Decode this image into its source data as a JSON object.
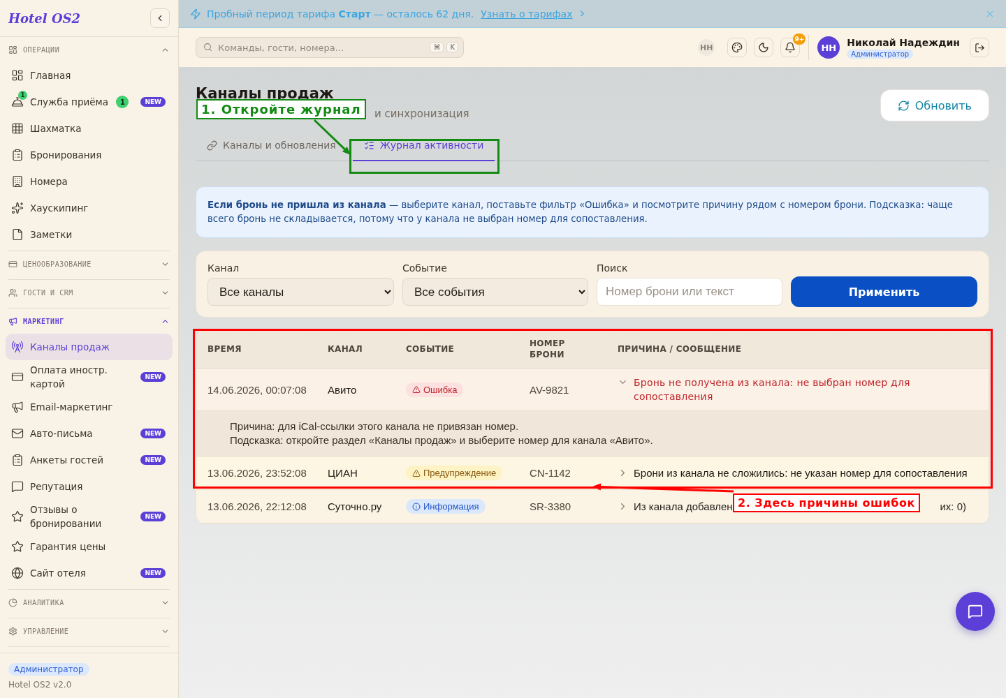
{
  "banner": {
    "text": "Пробный период тарифа **Старт** — осталось 62 дня.",
    "link": "Узнать о тарифах"
  },
  "sidebar": {
    "logo": "Hotel OS2",
    "sections": [
      {
        "title": "ОПЕРАЦИИ",
        "expanded": true,
        "items": [
          {
            "label": "Главная",
            "selected": false
          },
          {
            "label": "Служба приёма",
            "icon_badge": "1",
            "count": "1",
            "tag": "NEW",
            "selected": false
          },
          {
            "label": "Шахматка",
            "selected": false
          },
          {
            "label": "Бронирования",
            "selected": false
          },
          {
            "label": "Номера",
            "selected": false
          },
          {
            "label": "Хаускипинг",
            "selected": false
          },
          {
            "label": "Заметки",
            "selected": false
          }
        ]
      },
      {
        "title": "ЦЕНООБРАЗОВАНИЕ",
        "expanded": false
      },
      {
        "title": "ГОСТИ И CRM",
        "expanded": false
      },
      {
        "title": "МАРКЕТИНГ",
        "expanded": true,
        "items": [
          {
            "label": "Каналы продаж",
            "selected": true
          },
          {
            "label": "Оплата иностр. картой",
            "tag": "NEW",
            "selected": false
          },
          {
            "label": "Email-маркетинг",
            "selected": false
          },
          {
            "label": "Авто-письма",
            "tag": "NEW",
            "selected": false
          },
          {
            "label": "Анкеты гостей",
            "tag": "NEW",
            "selected": false
          },
          {
            "label": "Репутация",
            "selected": false
          },
          {
            "label": "Отзывы о бронировании",
            "tag": "NEW",
            "selected": false
          },
          {
            "label": "Гарантия цены",
            "selected": false
          },
          {
            "label": "Сайт отеля",
            "tag": "NEW",
            "selected": false
          }
        ]
      },
      {
        "title": "АНАЛИТИКА",
        "expanded": false
      },
      {
        "title": "УПРАВЛЕНИЕ",
        "expanded": false
      }
    ],
    "footer": {
      "role": "Администратор",
      "version": "Hotel OS2 v2.0"
    }
  },
  "header": {
    "search": {
      "placeholder": "Команды, гости, номера...",
      "keys": [
        "⌘",
        "K"
      ]
    },
    "presence": "НН",
    "notifications": "9+",
    "user": {
      "initials": "НН",
      "name": "Николай Надеждин",
      "role": "Администратор"
    }
  },
  "page": {
    "title": "Каналы продаж",
    "subtitle": "и синхронизация",
    "refresh": "Обновить",
    "tabs": [
      {
        "label": "Каналы и обновления",
        "selected": false
      },
      {
        "label": "Журнал активности",
        "selected": true
      }
    ],
    "info": "**Если бронь не пришла из канала** — выберите канал, поставьте фильтр «Ошибка» и посмотрите причину рядом с номером брони. Подсказка: чаще всего бронь не складывается, потому что у канала не выбран номер для сопоставления.",
    "filters": {
      "channel": {
        "label": "Канал",
        "value": "Все каналы"
      },
      "event": {
        "label": "Событие",
        "value": "Все события"
      },
      "search": {
        "label": "Поиск",
        "placeholder": "Номер брони или текст"
      },
      "apply": "Применить"
    },
    "table": {
      "columns": [
        "ВРЕМЯ",
        "КАНАЛ",
        "СОБЫТИЕ",
        "НОМЕР БРОНИ",
        "ПРИЧИНА / СООБЩЕНИЕ"
      ],
      "rows": [
        {
          "time": "14.06.2026, 00:07:08",
          "channel": "Авито",
          "event": {
            "kind": "error",
            "label": "Ошибка"
          },
          "booking": "AV-9821",
          "message": "Бронь не получена из канала: не выбран номер для сопоставления",
          "expanded": true,
          "details": [
            "Причина: для iCal-ссылки этого канала не привязан номер.",
            "Подсказка: откройте раздел «Каналы продаж» и выберите номер для канала «Авито»."
          ]
        },
        {
          "time": "13.06.2026, 23:52:08",
          "channel": "ЦИАН",
          "event": {
            "kind": "warning",
            "label": "Предупреждение"
          },
          "booking": "CN-1142",
          "message": "Брони из канала не сложились: не указан номер для сопоставления",
          "expanded": false
        },
        {
          "time": "13.06.2026, 22:12:08",
          "channel": "Суточно.ру",
          "event": {
            "kind": "info",
            "label": "Информация"
          },
          "booking": "SR-3380",
          "message": "Из канала добавлен",
          "message_tail": "их: 0)",
          "expanded": false
        }
      ]
    }
  },
  "annotations": [
    {
      "text": "1. Откройте журнал",
      "color": "#138a13"
    },
    {
      "text": "2. Здесь причины ошибок",
      "color": "#ff0000"
    }
  ]
}
